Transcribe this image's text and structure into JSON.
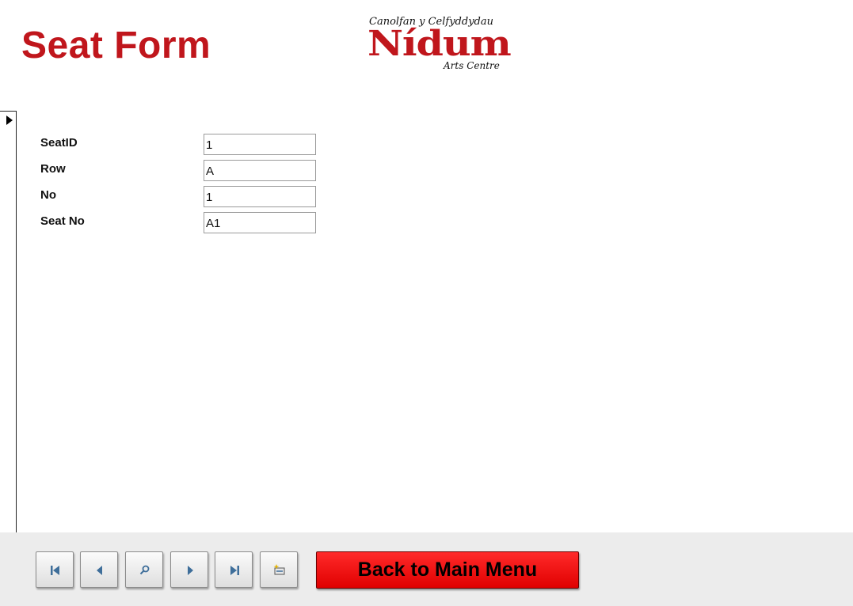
{
  "form": {
    "title": "Seat Form"
  },
  "logo": {
    "line1": "Canolfan y Celfyddydau",
    "name": "Nídum",
    "line3": "Arts Centre"
  },
  "fields": [
    {
      "label": "SeatID",
      "value": "1"
    },
    {
      "label": "Row",
      "value": "A"
    },
    {
      "label": "No",
      "value": "1"
    },
    {
      "label": "Seat No",
      "value": "A1"
    }
  ],
  "navigation": {
    "buttons": [
      {
        "icon": "first-record-icon"
      },
      {
        "icon": "previous-record-icon"
      },
      {
        "icon": "find-record-icon"
      },
      {
        "icon": "next-record-icon"
      },
      {
        "icon": "last-record-icon"
      },
      {
        "icon": "new-record-icon"
      }
    ],
    "main_menu_label": "Back to Main Menu"
  },
  "colors": {
    "title_red": "#c0161c",
    "menu_button_red": "#ff1a1a",
    "nav_icon_blue": "#3e6e9a",
    "footer_bg": "#ececec"
  }
}
